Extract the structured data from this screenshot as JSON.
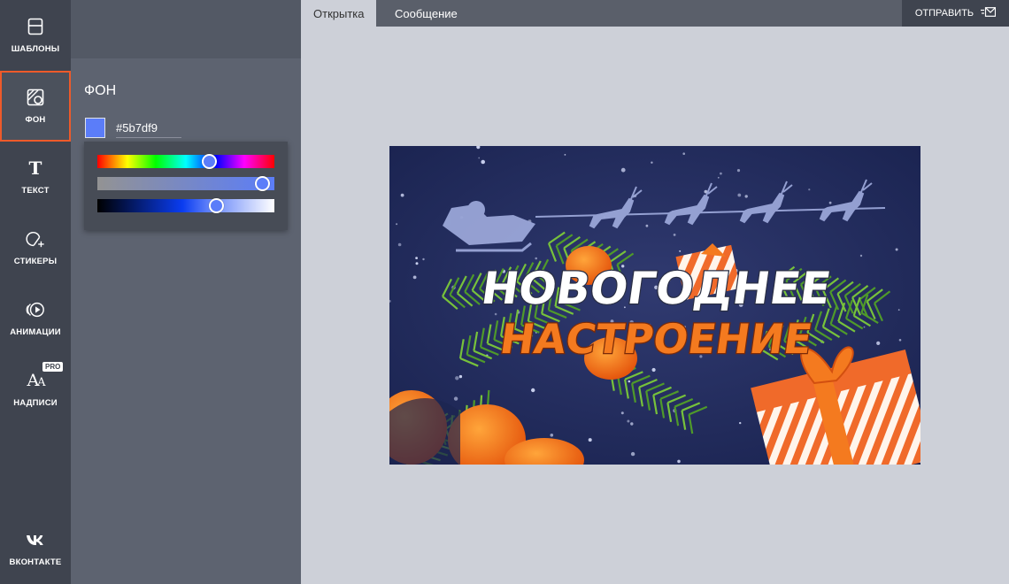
{
  "sidebar": {
    "items": [
      {
        "label": "ШАБЛОНЫ",
        "icon": "template-icon"
      },
      {
        "label": "ФОН",
        "icon": "background-icon",
        "active": true
      },
      {
        "label": "ТЕКСТ",
        "icon": "text-icon"
      },
      {
        "label": "СТИКЕРЫ",
        "icon": "sticker-icon"
      },
      {
        "label": "АНИМАЦИИ",
        "icon": "animation-icon"
      },
      {
        "label": "НАДПИСИ",
        "icon": "lettering-icon",
        "badge": "PRO"
      }
    ],
    "bottom": {
      "label": "ВКОНТАКТЕ",
      "icon": "vk-logo-icon"
    }
  },
  "panel": {
    "title": "ФОН",
    "color_value": "#5b7df9",
    "picker": {
      "hue": 0.63,
      "saturation": 0.93,
      "lightness": 0.67
    }
  },
  "topbar": {
    "tabs": [
      {
        "label": "Открытка",
        "active": true
      },
      {
        "label": "Сообщение",
        "active": false
      }
    ],
    "send_label": "ОТПРАВИТЬ"
  },
  "card": {
    "line1": "НОВОГОДНЕЕ",
    "line2": "НАСТРОЕНИЕ"
  },
  "colors": {
    "accent": "#ee5a2a",
    "rail_bg": "#3f444f",
    "panel_bg": "#5d6370",
    "canvas_bg": "#cdd0d8",
    "card_bg": "#222c5c",
    "orange": "#f47a1f"
  }
}
